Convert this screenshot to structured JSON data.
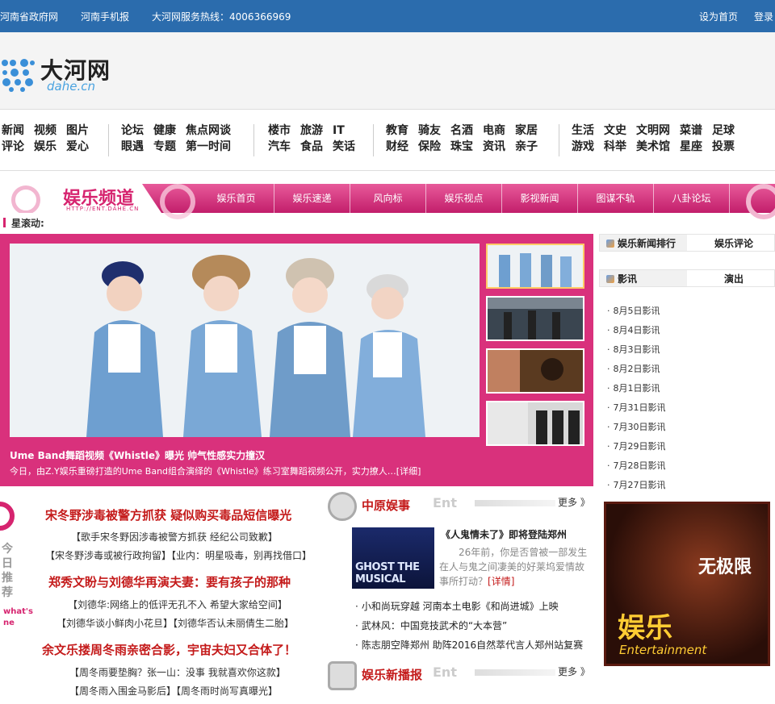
{
  "topbar": {
    "links": [
      "河南省政府网",
      "河南手机报",
      "大河网服务热线：4006366969"
    ],
    "right": [
      "设为首页",
      "登录"
    ]
  },
  "logo": {
    "cn": "大河网",
    "en": "dahe.cn"
  },
  "nav": {
    "groups": [
      {
        "rows": [
          [
            "新闻",
            "视频",
            "图片"
          ],
          [
            "评论",
            "娱乐",
            "爱心"
          ]
        ]
      },
      {
        "rows": [
          [
            "论坛",
            "健康",
            "焦点网谈"
          ],
          [
            "眼遇",
            "专题",
            "第一时间"
          ]
        ]
      },
      {
        "rows": [
          [
            "楼市",
            "旅游",
            "IT"
          ],
          [
            "汽车",
            "食品",
            "笑话"
          ]
        ]
      },
      {
        "rows": [
          [
            "教育",
            "骑友",
            "名酒",
            "电商",
            "家居"
          ],
          [
            "财经",
            "保险",
            "珠宝",
            "资讯",
            "亲子"
          ]
        ]
      },
      {
        "rows": [
          [
            "生活",
            "文史",
            "文明网",
            "菜谱",
            "足球"
          ],
          [
            "游戏",
            "科举",
            "美术馆",
            "星座",
            "投票"
          ]
        ]
      }
    ]
  },
  "channel": {
    "title": "娱乐频道",
    "subtitle": "HTTP://ENT.DAHE.CN",
    "menu": [
      "娱乐首页",
      "娱乐速递",
      "风向标",
      "娱乐视点",
      "影视新闻",
      "图谋不轨",
      "八卦论坛"
    ]
  },
  "scroll": {
    "label": "星滚动:"
  },
  "slider": {
    "title": "Ume Band舞蹈视频《Whistle》曝光 帅气性感实力撞汉",
    "text": "今日，由Z.Y娱乐重磅打造的Ume Band组合演绎的《Whistle》练习室舞蹈视频公开，实力撩人…",
    "more": "[详细]"
  },
  "rank": {
    "tabs1": [
      "娱乐新闻排行",
      "娱乐评论"
    ],
    "tabs2": [
      "影讯",
      "演出"
    ],
    "items": [
      "8月5日影讯",
      "8月4日影讯",
      "8月3日影讯",
      "8月2日影讯",
      "8月1日影讯",
      "7月31日影讯",
      "7月30日影讯",
      "7月29日影讯",
      "7月28日影讯",
      "7月27日影讯"
    ]
  },
  "ad": {
    "w1": "无极限",
    "w2": "娱乐",
    "w3": "Entertainment"
  },
  "today": {
    "vertical": "今日推荐",
    "vertical_en": "what's ne",
    "headline1": "宋冬野涉毒被警方抓获 疑似购买毒品短信曝光",
    "sub1a": "【歌手宋冬野因涉毒被警方抓获 经纪公司致歉】",
    "sub1b": "【宋冬野涉毒或被行政拘留】【业内：明星吸毒，别再找借口】",
    "headline2": "郑秀文盼与刘德华再演夫妻：要有孩子的那种",
    "sub2a": "【刘德华:网络上的低评无孔不入 希望大家给空间】",
    "sub2b": "【刘德华谈小鲜肉小花旦】【刘德华否认未丽倩生二胎】",
    "headline3": "余文乐搂周冬雨亲密合影，宇宙夫妇又合体了！",
    "sub3a": "【周冬雨要垫胸？张一山：没事 我就喜欢你这款】",
    "sub3b": "【周冬雨入围金马影后】【周冬雨时尚写真曝光】"
  },
  "zhongyuan": {
    "title": "中原娱事",
    "en": "Ent",
    "more": "更多 》",
    "feat_img_text": "GHOST THE MUSICAL",
    "feat_title": "《人鬼情未了》即将登陆郑州",
    "feat_body": "26年前，你是否曾被一部发生在人与鬼之间凄美的好莱坞爱情故事所打动？",
    "feat_more": "[详情]",
    "list": [
      "小和尚玩穿越 河南本土电影《和尚进城》上映",
      "武林风：中国竞技武术的“大本营”",
      "陈志朋空降郑州 助阵2016自然萃代言人郑州站复赛"
    ]
  },
  "xinbobao": {
    "title": "娱乐新播报",
    "en": "Ent",
    "more": "更多 》"
  }
}
